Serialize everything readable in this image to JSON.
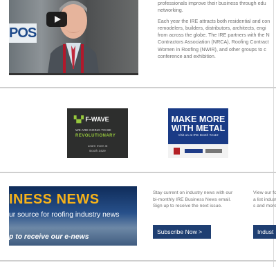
{
  "intro": {
    "p1": "professionals improve their business through edu networking.",
    "p2": "Each year the IRE attracts both residential and con remodelers, builders, distributors, architects, engi from across the globe. The IRE partners with the N Contractors Association (NRCA), Roofing Contract Women in Roofing (NWIR), and other groups to c conference and exhibition."
  },
  "ads": {
    "fwave": {
      "brand": "F-WAVE",
      "line1": "WE ARE GOING TO BE",
      "line2": "REVOLUTIONARY",
      "line3": "Learn more at",
      "line4": "Booth 3429"
    },
    "metal": {
      "headline": "MAKE MORE WITH METAL",
      "sub": "Visit us at IRE Booth #2119"
    }
  },
  "news_banner": {
    "title": "INESS NEWS",
    "tagline": "ur source for roofing industry news",
    "cta": "p to receive our e-news"
  },
  "subscribe": {
    "text": "Stay current on industry news with our bi-monthly IRE Business News email. Sign up to receive the next issue.",
    "button": "Subscribe Now >"
  },
  "second_column": {
    "text": "View our for a list industry s and more",
    "button": "Indust"
  },
  "colors": {
    "button_bg": "#1f3f72",
    "divider": "#cfcfcf",
    "metal_ad_bg": "#1a3b86",
    "news_title": "#f6b21a"
  }
}
